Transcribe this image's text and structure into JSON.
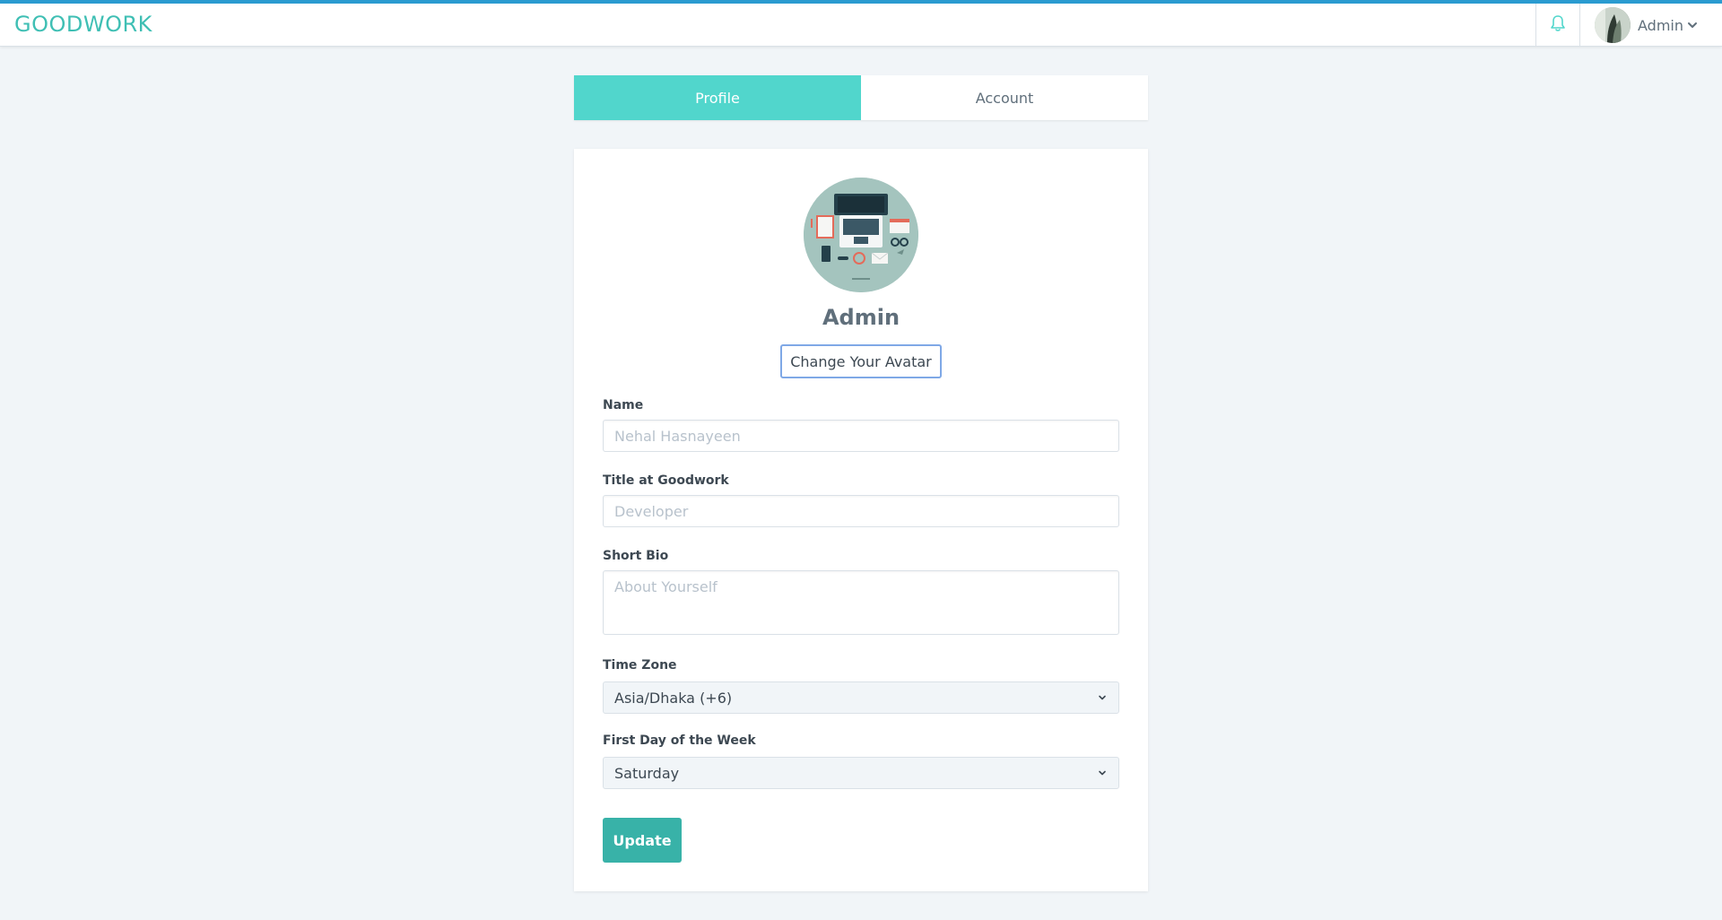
{
  "header": {
    "brand": "GOODWORK",
    "user_name": "Admin",
    "icons": {
      "notifications": "bell-icon",
      "menu": "chevron-down-icon"
    }
  },
  "tabs": [
    {
      "label": "Profile",
      "active": true
    },
    {
      "label": "Account",
      "active": false
    }
  ],
  "profile": {
    "display_name": "Admin",
    "change_avatar_label": "Change Your Avatar",
    "fields": {
      "name": {
        "label": "Name",
        "placeholder": "Nehal Hasnayeen"
      },
      "title": {
        "label": "Title at Goodwork",
        "placeholder": "Developer"
      },
      "bio": {
        "label": "Short Bio",
        "placeholder": "About Yourself"
      },
      "timezone": {
        "label": "Time Zone",
        "value": "Asia/Dhaka (+6)"
      },
      "first_day": {
        "label": "First Day of the Week",
        "value": "Saturday"
      }
    },
    "update_label": "Update"
  },
  "colors": {
    "accent": "#51d6cc",
    "button": "#38b2a8",
    "brand": "#3fbfb4",
    "topbar_border": "#2a9bd0"
  }
}
